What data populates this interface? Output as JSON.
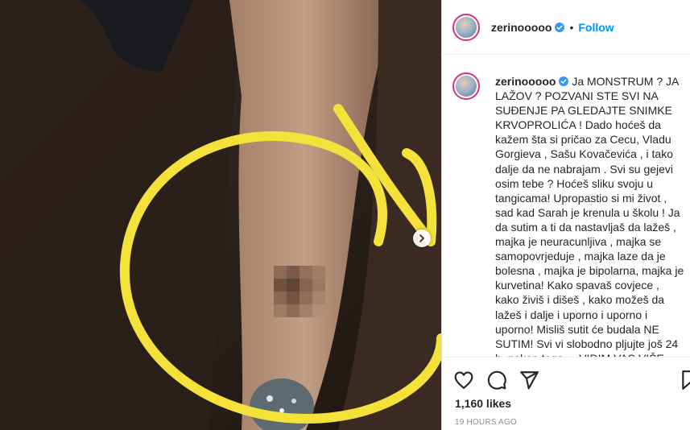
{
  "post": {
    "image_alt": "Photo of an arm with a yellow circle and arrow drawn over a pixelated area",
    "accent_color": "#f4e23a"
  },
  "header": {
    "username": "zerinooooo",
    "separator": "•",
    "follow_label": "Follow"
  },
  "caption": {
    "username": "zerinooooo",
    "text": "Ja MONSTRUM ? JA LAŽOV ? POZVANI STE SVI NA SUĐENJE PA GLEDAJTE SNIMKE KRVOPROLIĆA ! Dado hoćeš da kažem šta si pričao za Cecu, Vladu Gorgieva , Sašu Kovačevića , i tako dalje da ne nabrajam . Svi su gejevi osim tebe ? Hoćeš sliku svoju u tangicama! Upropastio si mi život , sad kad Sarah je krenula u školu ! Ja da sutim a ti da nastavljaš da lažeš , majka je neuracunljiva , majka se samopovrjeduje , majka laze da je bolesna , majka je bipolarna, majka je kurvetina! Kako spavaš covjece , kako živiš i dišeš , kako možeš da lažeš i dalje i uporno i uporno i uporno! Misliš sutit će budala NE SUTIM! Svi vi slobodno pljujte još 24 h, nakon toga ... VIDIM VAS VIŠE BAGRO"
  },
  "actions": {
    "likes": "1,160 likes",
    "timestamp": "19 HOURS AGO"
  },
  "colors": {
    "link": "#0095f6",
    "text": "#262626",
    "muted": "#8e8e8e",
    "story_ring": "#d9317a"
  }
}
